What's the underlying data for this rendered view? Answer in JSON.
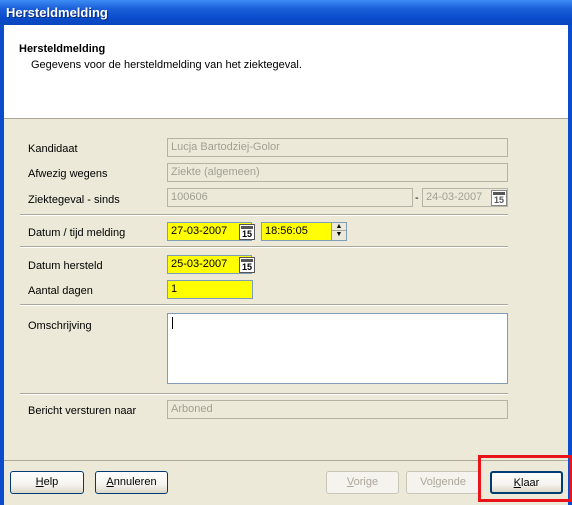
{
  "window": {
    "title": "Hersteldmelding"
  },
  "header": {
    "title": "Hersteldmelding",
    "subtitle": "Gegevens voor de hersteldmelding van het ziektegeval."
  },
  "form": {
    "kandidaat": {
      "label": "Kandidaat",
      "value": "Lucja Bartodziej-Golor"
    },
    "afwezig": {
      "label": "Afwezig wegens",
      "value": "Ziekte (algemeen)"
    },
    "ziektegeval": {
      "label": "Ziektegeval - sinds",
      "value": "100606",
      "separator": "-",
      "date": "24-03-2007"
    },
    "melding": {
      "label": "Datum / tijd melding",
      "date": "27-03-2007",
      "time": "18:56:05"
    },
    "hersteld": {
      "label": "Datum hersteld",
      "date": "25-03-2007"
    },
    "dagen": {
      "label": "Aantal dagen",
      "value": "1"
    },
    "omschrijving": {
      "label": "Omschrijving",
      "value": ""
    },
    "bericht": {
      "label": "Bericht versturen naar",
      "value": "Arboned"
    },
    "calendar_glyph": "15"
  },
  "buttons": {
    "help": {
      "label": "Help",
      "underline": "H",
      "rest": "elp"
    },
    "annuleren": {
      "label": "Annuleren",
      "underline": "A",
      "rest": "nnuleren"
    },
    "vorige": {
      "label": "Vorige",
      "underline": "V",
      "rest": "orige"
    },
    "volgende": {
      "pre": "Vo",
      "underline": "l",
      "rest": "gende",
      "label": "Volgende"
    },
    "klaar": {
      "label": "Klaar",
      "underline": "K",
      "rest": "laar"
    }
  },
  "colors": {
    "required": "#ffff00",
    "highlight": "#e8141a",
    "titlebar": "#0a4ccc"
  }
}
